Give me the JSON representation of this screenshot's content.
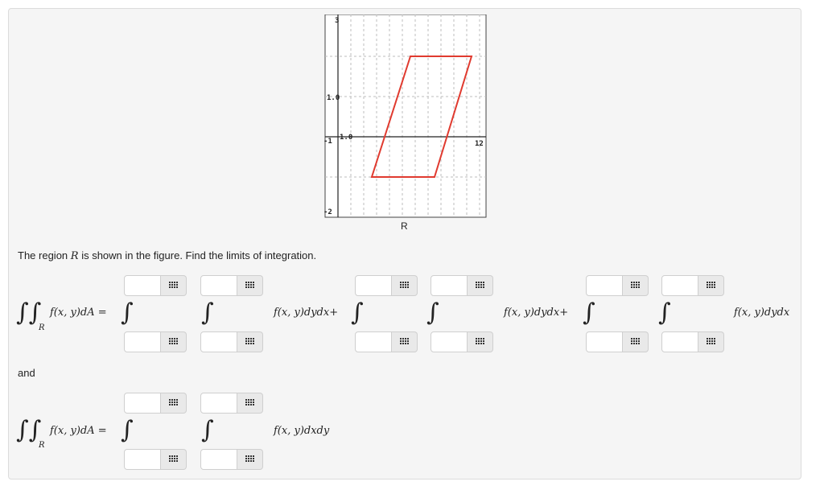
{
  "figure": {
    "caption": "R",
    "labels": {
      "y_top": "3",
      "y_mid": "1.0",
      "x_left": "-1",
      "x_mid": "1.0",
      "x_right": "12",
      "y_bottom": "-2"
    },
    "region_color": "#e03a2f",
    "axis_color": "#222222",
    "grid_color": "#bdbdbd"
  },
  "question": {
    "prefix": "The region",
    "region": "R",
    "suffix": "is shown in the figure. Find the limits of integration."
  },
  "equation1": {
    "lhs": "f(x, y)dA =",
    "sub": "R",
    "term1": "f(x, y)dydx+",
    "term2": "f(x, y)dydx+",
    "term3": "f(x, y)dydx"
  },
  "and_label": "and",
  "equation2": {
    "lhs": "f(x, y)dA =",
    "sub": "R",
    "term1": "f(x, y)dxdy"
  },
  "inputs": {
    "value": "",
    "keyboard_icon": "keypad-icon"
  },
  "colors": {
    "panel_bg": "#f5f5f5",
    "region": "#e03a2f"
  }
}
